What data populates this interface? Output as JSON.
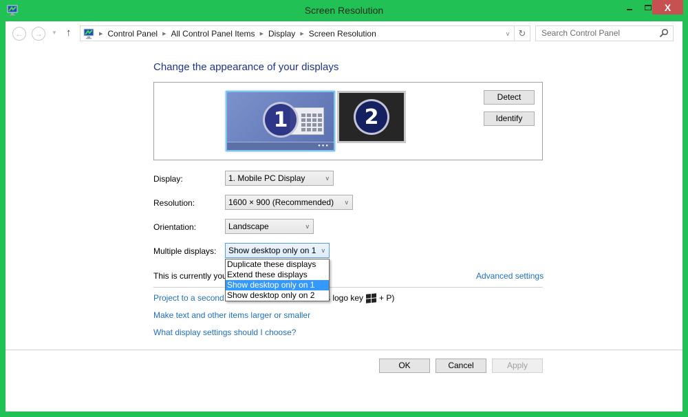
{
  "window": {
    "title": "Screen Resolution",
    "minimize_label": "",
    "maximize_label": "",
    "close_label": "X"
  },
  "navigation": {
    "back_glyph": "←",
    "forward_glyph": "→",
    "recent_glyph": "▼",
    "up_glyph": "↑",
    "breadcrumbs": [
      "Control Panel",
      "All Control Panel Items",
      "Display",
      "Screen Resolution"
    ],
    "dropdown_glyph": "v",
    "refresh_glyph": "↻",
    "search_placeholder": "Search Control Panel"
  },
  "main": {
    "heading": "Change the appearance of your displays",
    "monitors": [
      {
        "number": "1",
        "selected": true
      },
      {
        "number": "2",
        "selected": false
      }
    ],
    "detect_label": "Detect",
    "identify_label": "Identify",
    "fields": {
      "display": {
        "label": "Display:",
        "value": "1. Mobile PC Display"
      },
      "resolution": {
        "label": "Resolution:",
        "value": "1600 × 900 (Recommended)"
      },
      "orientation": {
        "label": "Orientation:",
        "value": "Landscape"
      },
      "multiple_displays": {
        "label": "Multiple displays:",
        "value": "Show desktop only on 1",
        "options": [
          "Duplicate these displays",
          "Extend these displays",
          "Show desktop only on 1",
          "Show desktop only on 2"
        ],
        "highlighted_index": 2
      }
    },
    "chevron_glyph": "v",
    "info_text": "This is currently you",
    "advanced_settings_link": "Advanced settings",
    "project_link": "Project to a second",
    "project_tail_prefix": "s logo key",
    "project_tail_suffix": "+ P)",
    "text_size_link": "Make text and other items larger or smaller",
    "help_link": "What display settings should I choose?"
  },
  "footer": {
    "ok_label": "OK",
    "cancel_label": "Cancel",
    "apply_label": "Apply"
  }
}
